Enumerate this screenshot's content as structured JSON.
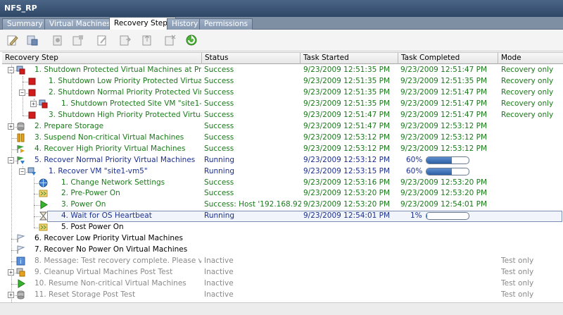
{
  "window": {
    "title": "NFS_RP"
  },
  "tabs": [
    {
      "label": "Summary"
    },
    {
      "label": "Virtual Machines"
    },
    {
      "label": "Recovery Steps"
    },
    {
      "label": "History"
    },
    {
      "label": "Permissions"
    }
  ],
  "active_tab": 2,
  "toolbar": [
    "edit-step-icon",
    "save-icon",
    "delete-icon",
    "add-icon",
    "copy-icon",
    "export-icon",
    "import-icon",
    "remove-icon",
    "refresh-icon"
  ],
  "columns": {
    "step": "Recovery Step",
    "status": "Status",
    "started": "Task Started",
    "completed": "Task Completed",
    "mode": "Mode"
  },
  "rows": [
    {
      "name": "1. Shutdown Protected Virtual Machines at Prot...",
      "status": "Success",
      "started": "9/23/2009 12:51:35 PM",
      "completed": "9/23/2009 12:51:47 PM",
      "mode": "Recovery only",
      "color": "green",
      "icon": "shutdown-group-icon",
      "level": 0,
      "expander": "−"
    },
    {
      "name": "1. Shutdown Low Priority Protected Virtual...",
      "status": "Success",
      "started": "9/23/2009 12:51:35 PM",
      "completed": "9/23/2009 12:51:35 PM",
      "mode": "Recovery only",
      "color": "green",
      "icon": "stop-icon",
      "level": 1,
      "expander": ""
    },
    {
      "name": "2. Shutdown Normal Priority Protected Virt...",
      "status": "Success",
      "started": "9/23/2009 12:51:35 PM",
      "completed": "9/23/2009 12:51:47 PM",
      "mode": "Recovery only",
      "color": "green",
      "icon": "stop-icon",
      "level": 1,
      "expander": "−"
    },
    {
      "name": "1. Shutdown Protected Site VM \"site1-...",
      "status": "Success",
      "started": "9/23/2009 12:51:35 PM",
      "completed": "9/23/2009 12:51:47 PM",
      "mode": "Recovery only",
      "color": "green",
      "icon": "vm-shutdown-icon",
      "level": 2,
      "expander": "+"
    },
    {
      "name": "3. Shutdown High Priority Protected Virtual...",
      "status": "Success",
      "started": "9/23/2009 12:51:47 PM",
      "completed": "9/23/2009 12:51:47 PM",
      "mode": "Recovery only",
      "color": "green",
      "icon": "stop-icon",
      "level": 1,
      "expander": ""
    },
    {
      "name": "2. Prepare Storage",
      "status": "Success",
      "started": "9/23/2009 12:51:47 PM",
      "completed": "9/23/2009 12:53:12 PM",
      "mode": "",
      "color": "green",
      "icon": "storage-icon",
      "level": 0,
      "expander": "+"
    },
    {
      "name": "3. Suspend Non-critical Virtual Machines",
      "status": "Success",
      "started": "9/23/2009 12:53:12 PM",
      "completed": "9/23/2009 12:53:12 PM",
      "mode": "",
      "color": "green",
      "icon": "pause-icon",
      "level": 0,
      "expander": ""
    },
    {
      "name": "4. Recover High Priority Virtual Machines",
      "status": "Success",
      "started": "9/23/2009 12:53:12 PM",
      "completed": "9/23/2009 12:53:12 PM",
      "mode": "",
      "color": "green",
      "icon": "flag-icon",
      "level": 0,
      "expander": ""
    },
    {
      "name": "5. Recover Normal Priority Virtual Machines",
      "status": "Running",
      "started": "9/23/2009 12:53:12 PM",
      "completed": "",
      "progress": 60,
      "progress_label": "60%",
      "mode": "",
      "color": "blue",
      "icon": "flag-running-icon",
      "level": 0,
      "expander": "−"
    },
    {
      "name": "1. Recover VM \"site1-vm5\"",
      "status": "Running",
      "started": "9/23/2009 12:53:15 PM",
      "completed": "",
      "progress": 60,
      "progress_label": "60%",
      "mode": "",
      "color": "blue",
      "icon": "vm-recover-icon",
      "level": 1,
      "expander": "−"
    },
    {
      "name": "1. Change Network Settings",
      "status": "Success",
      "started": "9/23/2009 12:53:16 PM",
      "completed": "9/23/2009 12:53:20 PM",
      "mode": "",
      "color": "green",
      "icon": "network-icon",
      "level": 2,
      "expander": ""
    },
    {
      "name": "2. Pre-Power On",
      "status": "Success",
      "started": "9/23/2009 12:53:20 PM",
      "completed": "9/23/2009 12:53:20 PM",
      "mode": "",
      "color": "green",
      "icon": "script-icon",
      "level": 2,
      "expander": ""
    },
    {
      "name": "3. Power On",
      "status": "Success: Host '192.168.92...",
      "started": "9/23/2009 12:53:20 PM",
      "completed": "9/23/2009 12:54:01 PM",
      "mode": "",
      "color": "green",
      "icon": "play-icon",
      "level": 2,
      "expander": ""
    },
    {
      "name": "4. Wait for OS Heartbeat",
      "status": "Running",
      "started": "9/23/2009 12:54:01 PM",
      "completed": "",
      "progress": 1,
      "progress_label": "1%",
      "mode": "",
      "color": "blue",
      "icon": "hourglass-icon",
      "level": 2,
      "expander": "",
      "selected": true
    },
    {
      "name": "5. Post Power On",
      "status": "",
      "started": "",
      "completed": "",
      "mode": "",
      "color": "black",
      "icon": "script-icon",
      "level": 2,
      "expander": ""
    },
    {
      "name": "6. Recover Low Priority Virtual Machines",
      "status": "",
      "started": "",
      "completed": "",
      "mode": "",
      "color": "black",
      "icon": "flag-pending-icon",
      "level": 0,
      "expander": ""
    },
    {
      "name": "7. Recover No Power On Virtual Machines",
      "status": "",
      "started": "",
      "completed": "",
      "mode": "",
      "color": "black",
      "icon": "flag-pending-icon",
      "level": 0,
      "expander": ""
    },
    {
      "name": "8. Message: Test recovery complete. Please ver...",
      "status": "Inactive",
      "started": "",
      "completed": "",
      "mode": "Test only",
      "color": "gray",
      "icon": "message-icon",
      "level": 0,
      "expander": ""
    },
    {
      "name": "9. Cleanup Virtual Machines Post Test",
      "status": "Inactive",
      "started": "",
      "completed": "",
      "mode": "Test only",
      "color": "gray",
      "icon": "cleanup-icon",
      "level": 0,
      "expander": "+"
    },
    {
      "name": "10. Resume Non-critical Virtual Machines",
      "status": "Inactive",
      "started": "",
      "completed": "",
      "mode": "Test only",
      "color": "gray",
      "icon": "play-icon",
      "level": 0,
      "expander": ""
    },
    {
      "name": "11. Reset Storage Post Test",
      "status": "Inactive",
      "started": "",
      "completed": "",
      "mode": "Test only",
      "color": "gray",
      "icon": "storage-icon",
      "level": 0,
      "expander": "+"
    }
  ]
}
